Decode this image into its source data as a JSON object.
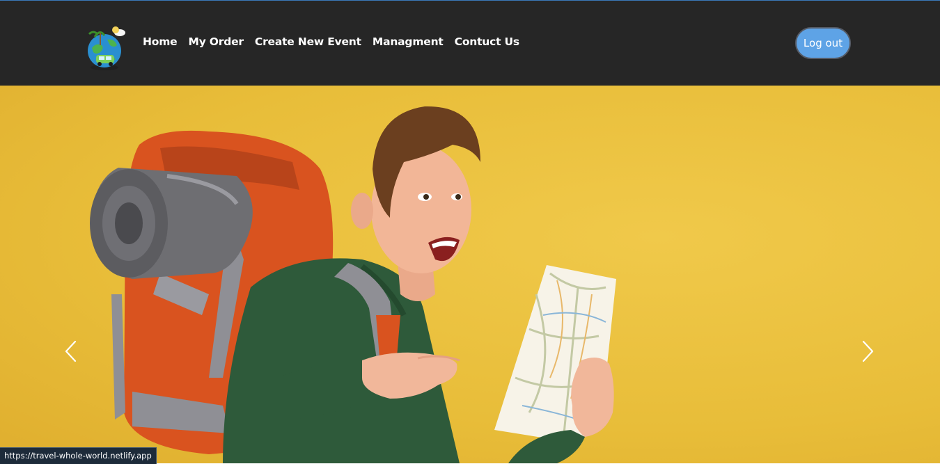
{
  "nav": {
    "logo_icon": "travel-globe-logo-icon",
    "links": [
      {
        "label": "Home"
      },
      {
        "label": "My Order"
      },
      {
        "label": "Create New Event"
      },
      {
        "label": "Managment"
      },
      {
        "label": "Contuct Us"
      }
    ],
    "logout_label": "Log out"
  },
  "carousel": {
    "slide_image": "traveler-with-backpack-and-map",
    "prev_icon": "chevron-left-icon",
    "next_icon": "chevron-right-icon"
  },
  "status_bar": {
    "url": "https://travel-whole-world.netlify.app"
  },
  "colors": {
    "navbar_bg": "#262626",
    "hero_bg": "#e8bd39",
    "logout_bg": "#5ea3e6"
  }
}
